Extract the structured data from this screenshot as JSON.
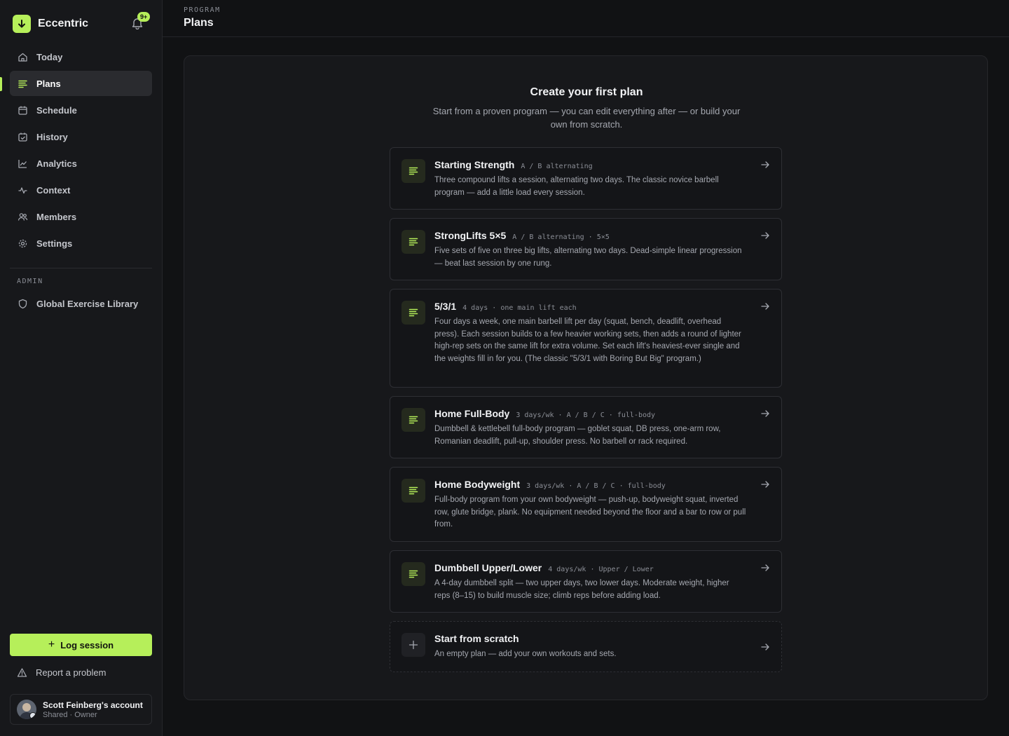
{
  "app": {
    "name": "Eccentric",
    "notification_badge": "9+",
    "accent_color": "#b6ef5a"
  },
  "sidebar": {
    "items": [
      {
        "label": "Today",
        "icon": "home-icon"
      },
      {
        "label": "Plans",
        "icon": "list-icon",
        "active": true
      },
      {
        "label": "Schedule",
        "icon": "calendar-icon"
      },
      {
        "label": "History",
        "icon": "calendar-check-icon"
      },
      {
        "label": "Analytics",
        "icon": "chart-line-icon"
      },
      {
        "label": "Context",
        "icon": "activity-icon"
      },
      {
        "label": "Members",
        "icon": "users-icon"
      },
      {
        "label": "Settings",
        "icon": "gear-icon"
      }
    ],
    "admin_label": "ADMIN",
    "admin_items": [
      {
        "label": "Global Exercise Library",
        "icon": "shield-icon"
      }
    ],
    "log_session_label": "Log session",
    "report_label": "Report a problem",
    "account": {
      "name": "Scott Feinberg's account",
      "sub": "Shared · Owner"
    }
  },
  "header": {
    "eyebrow": "PROGRAM",
    "title": "Plans"
  },
  "main": {
    "title": "Create your first plan",
    "subtitle": "Start from a proven program — you can edit everything after — or build your own from scratch.",
    "plans": [
      {
        "name": "Starting Strength",
        "meta": "A / B alternating",
        "description": "Three compound lifts a session, alternating two days. The classic novice barbell program — add a little load every session."
      },
      {
        "name": "StrongLifts 5×5",
        "meta": "A / B alternating · 5×5",
        "description": "Five sets of five on three big lifts, alternating two days. Dead-simple linear progression — beat last session by one rung."
      },
      {
        "name": "5/3/1",
        "meta": "4 days · one main lift each",
        "description": "Four days a week, one main barbell lift per day (squat, bench, deadlift, overhead press). Each session builds to a few heavier working sets, then adds a round of lighter high-rep sets on the same lift for extra volume. Set each lift's heaviest-ever single and the weights fill in for you. (The classic \"5/3/1 with Boring But Big\" program.)"
      },
      {
        "name": "Home Full-Body",
        "meta": "3 days/wk · A / B / C · full-body",
        "description": "Dumbbell & kettlebell full-body program — goblet squat, DB press, one-arm row, Romanian deadlift, pull-up, shoulder press. No barbell or rack required."
      },
      {
        "name": "Home Bodyweight",
        "meta": "3 days/wk · A / B / C · full-body",
        "description": "Full-body program from your own bodyweight — push-up, bodyweight squat, inverted row, glute bridge, plank. No equipment needed beyond the floor and a bar to row or pull from."
      },
      {
        "name": "Dumbbell Upper/Lower",
        "meta": "4 days/wk · Upper / Lower",
        "description": "A 4-day dumbbell split — two upper days, two lower days. Moderate weight, higher reps (8–15) to build muscle size; climb reps before adding load."
      }
    ],
    "scratch": {
      "name": "Start from scratch",
      "description": "An empty plan — add your own workouts and sets."
    }
  }
}
